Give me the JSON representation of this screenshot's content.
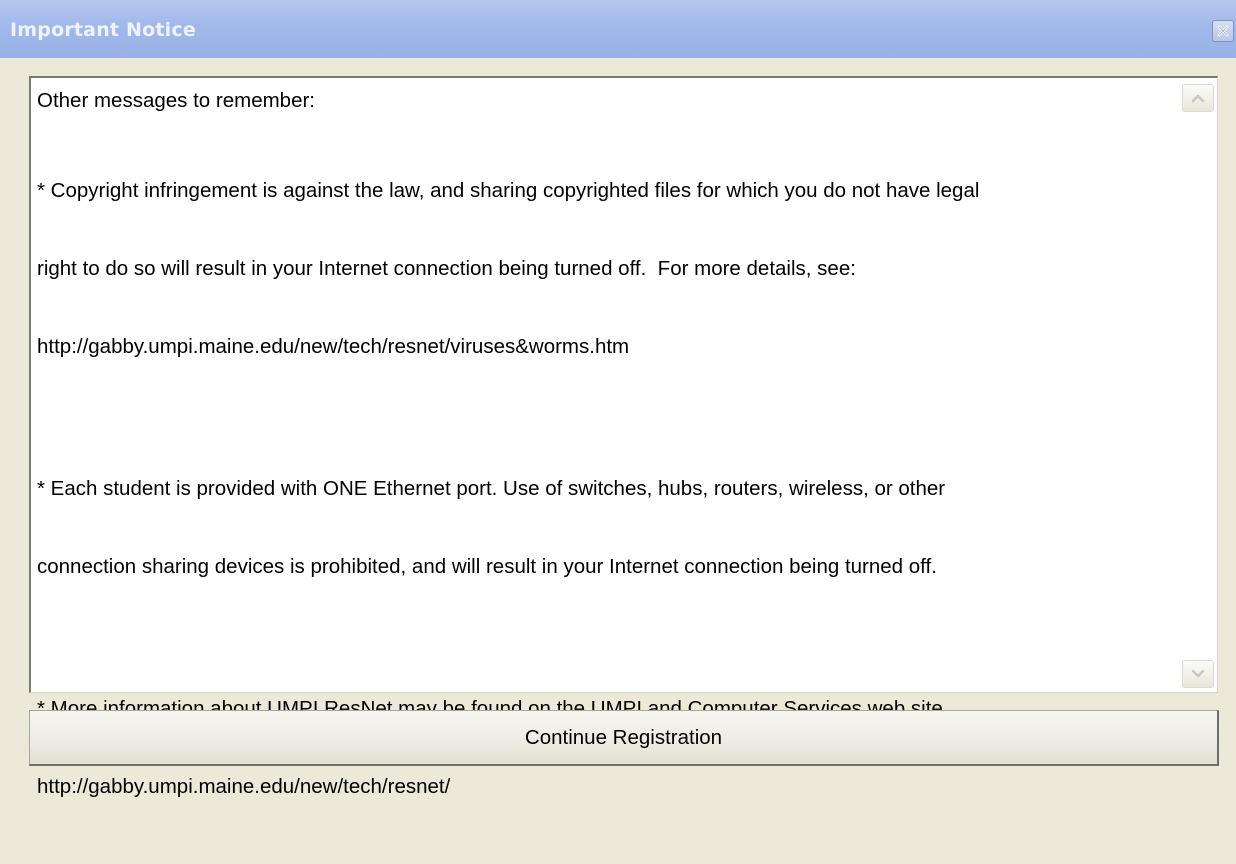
{
  "window": {
    "title": "Important Notice",
    "close_icon": "close-icon",
    "colors": {
      "titlebar": "#a3b9ea",
      "title_text": "#eef3ff",
      "background": "#ece9d8"
    }
  },
  "notice": {
    "intro": "Other messages to remember:",
    "paragraphs": [
      {
        "lines": [
          "* Copyright infringement is against the law, and sharing copyrighted files for which you do not have legal",
          "right to do so will result in your Internet connection being turned off.  For more details, see:",
          "http://gabby.umpi.maine.edu/new/tech/resnet/viruses&worms.htm"
        ]
      },
      {
        "lines": [
          "* Each student is provided with ONE Ethernet port. Use of switches, hubs, routers, wireless, or other",
          "connection sharing devices is prohibited, and will result in your Internet connection being turned off."
        ]
      },
      {
        "lines": [
          "* More information about UMPI ResNet may be found on the UMPI and Computer Services web site.",
          "http://gabby.umpi.maine.edu/new/tech/resnet/"
        ]
      }
    ]
  },
  "scrollbar": {
    "up_icon": "chevron-up-icon",
    "down_icon": "chevron-down-icon"
  },
  "footer": {
    "continue_label": "Continue Registration"
  }
}
